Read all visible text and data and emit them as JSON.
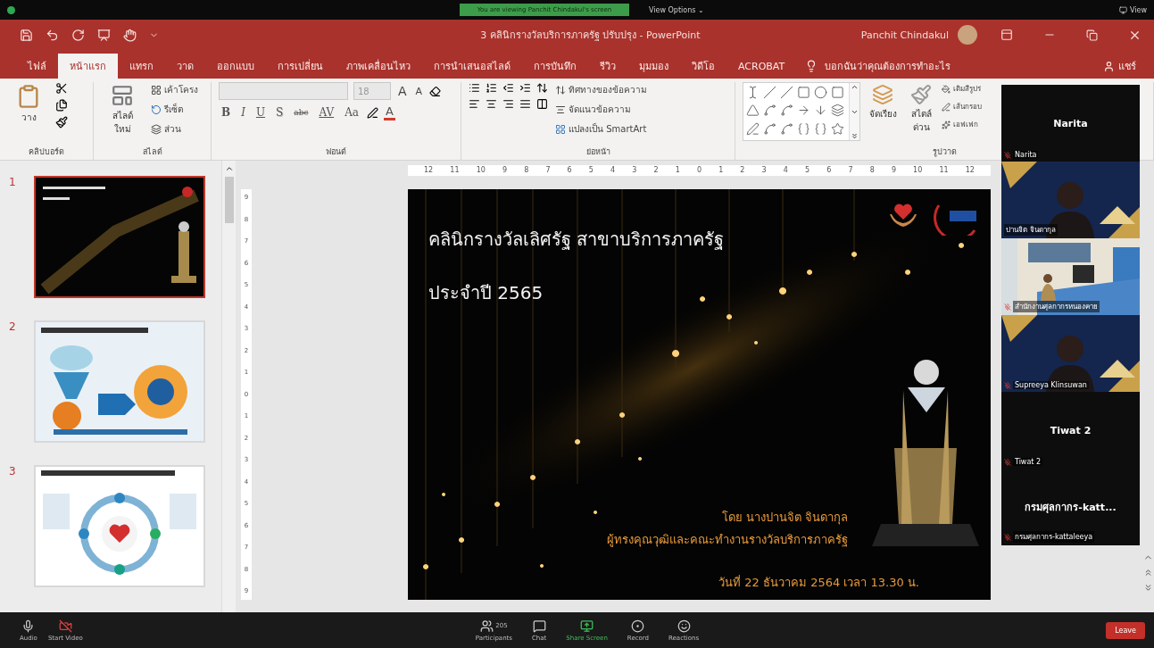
{
  "zoom_top_bar": {
    "banner": "You are viewing Panchit Chindakul's screen",
    "view_options": "View Options ⌄",
    "view": "View"
  },
  "window": {
    "title": "3 คลินิกรางวัลบริการภาครัฐ ปรับปรุง  -  PowerPoint",
    "user": "Panchit Chindakul"
  },
  "ribbon_tabs": [
    {
      "label": "ไฟล์",
      "selected": false
    },
    {
      "label": "หน้าแรก",
      "selected": true
    },
    {
      "label": "แทรก",
      "selected": false
    },
    {
      "label": "วาด",
      "selected": false
    },
    {
      "label": "ออกแบบ",
      "selected": false
    },
    {
      "label": "การเปลี่ยน",
      "selected": false
    },
    {
      "label": "ภาพเคลื่อนไหว",
      "selected": false
    },
    {
      "label": "การนำเสนอสไลด์",
      "selected": false
    },
    {
      "label": "การบันทึก",
      "selected": false
    },
    {
      "label": "รีวิว",
      "selected": false
    },
    {
      "label": "มุมมอง",
      "selected": false
    },
    {
      "label": "วิดีโอ",
      "selected": false
    },
    {
      "label": "ACROBAT",
      "selected": false
    }
  ],
  "tell_me": "บอกฉันว่าคุณต้องการทำอะไร",
  "share": "แชร์",
  "ribbon": {
    "clipboard": {
      "paste": "วาง",
      "label": "คลิปบอร์ด"
    },
    "slides": {
      "new_slide": "สไลด์ ใหม่",
      "layout": "เค้าโครง",
      "reset": "รีเซ็ต",
      "section": "ส่วน",
      "label": "สไลด์"
    },
    "font": {
      "font_size": "18",
      "grow": "A",
      "shrink": "A",
      "font_color": "A",
      "format_buttons": [
        {
          "label": "B",
          "kind": "bold"
        },
        {
          "label": "I",
          "kind": "italic"
        },
        {
          "label": "U",
          "kind": "underline"
        },
        {
          "label": "S",
          "kind": "shadow"
        },
        {
          "label": "abc",
          "kind": "strike"
        },
        {
          "label": "AV",
          "kind": "spacing"
        },
        {
          "label": "Aa",
          "kind": "case"
        }
      ],
      "label": "ฟอนต์"
    },
    "paragraph": {
      "text_direction": "ทิศทางของข้อความ",
      "align_text": "จัดแนวข้อความ",
      "smartart": "แปลงเป็น SmartArt",
      "label": "ย่อหน้า"
    },
    "drawing": {
      "arrange": "จัดเรียง",
      "quick_styles": "สไตล์ ด่วน",
      "shape_fill": "เติมสีรูปร่",
      "shape_outline": "เส้นกรอบ",
      "shape_effects": "เอฟเฟก",
      "label": "รูปวาด"
    }
  },
  "slide_thumbnails": [
    {
      "number": "1",
      "kind": "title",
      "selected": true
    },
    {
      "number": "2",
      "kind": "chart",
      "selected": false
    },
    {
      "number": "3",
      "kind": "diagram",
      "selected": false
    }
  ],
  "ruler": {
    "horizontal": [
      "12",
      "11",
      "10",
      "9",
      "8",
      "7",
      "6",
      "5",
      "4",
      "3",
      "2",
      "1",
      "0",
      "1",
      "2",
      "3",
      "4",
      "5",
      "6",
      "7",
      "8",
      "9",
      "10",
      "11",
      "12"
    ],
    "vertical": [
      "9",
      "8",
      "7",
      "6",
      "5",
      "4",
      "3",
      "2",
      "1",
      "0",
      "1",
      "2",
      "3",
      "4",
      "5",
      "6",
      "7",
      "8",
      "9"
    ]
  },
  "slide": {
    "title": "คลินิกรางวัลเลิศรัฐ สาขาบริการภาครัฐ",
    "subtitle": "ประจำปี 2565",
    "presenter": "โดย นางปานจิต จินดากุล",
    "team": "ผู้ทรงคุณวุฒิและคณะทำงานรางวัลบริการภาครัฐ",
    "date": "วันที่ 22 ธันวาคม 2564 เวลา 13.30 น."
  },
  "video_gallery": [
    {
      "kind": "name",
      "name": "Narita",
      "label": "Narita",
      "muted": true
    },
    {
      "kind": "webcam",
      "label": "ปานจิต จินดากุล",
      "muted": false
    },
    {
      "kind": "room",
      "label": "สำนักงานศุลกากรหนองคาย",
      "muted": true
    },
    {
      "kind": "webcam",
      "label": "Supreeya Klinsuwan",
      "muted": true
    },
    {
      "kind": "name",
      "name": "Tiwat 2",
      "label": "Tiwat 2",
      "muted": true
    },
    {
      "kind": "name",
      "name": "กรมศุลกากร-katt...",
      "label": "กรมศุลกากร-kattaleeya",
      "muted": true
    }
  ],
  "meeting_toolbar": {
    "audio": "Audio",
    "video": "Start Video",
    "participants": "Participants",
    "participant_count": "205",
    "chat": "Chat",
    "share_screen": "Share Screen",
    "record": "Record",
    "reactions": "Reactions",
    "leave": "Leave"
  }
}
